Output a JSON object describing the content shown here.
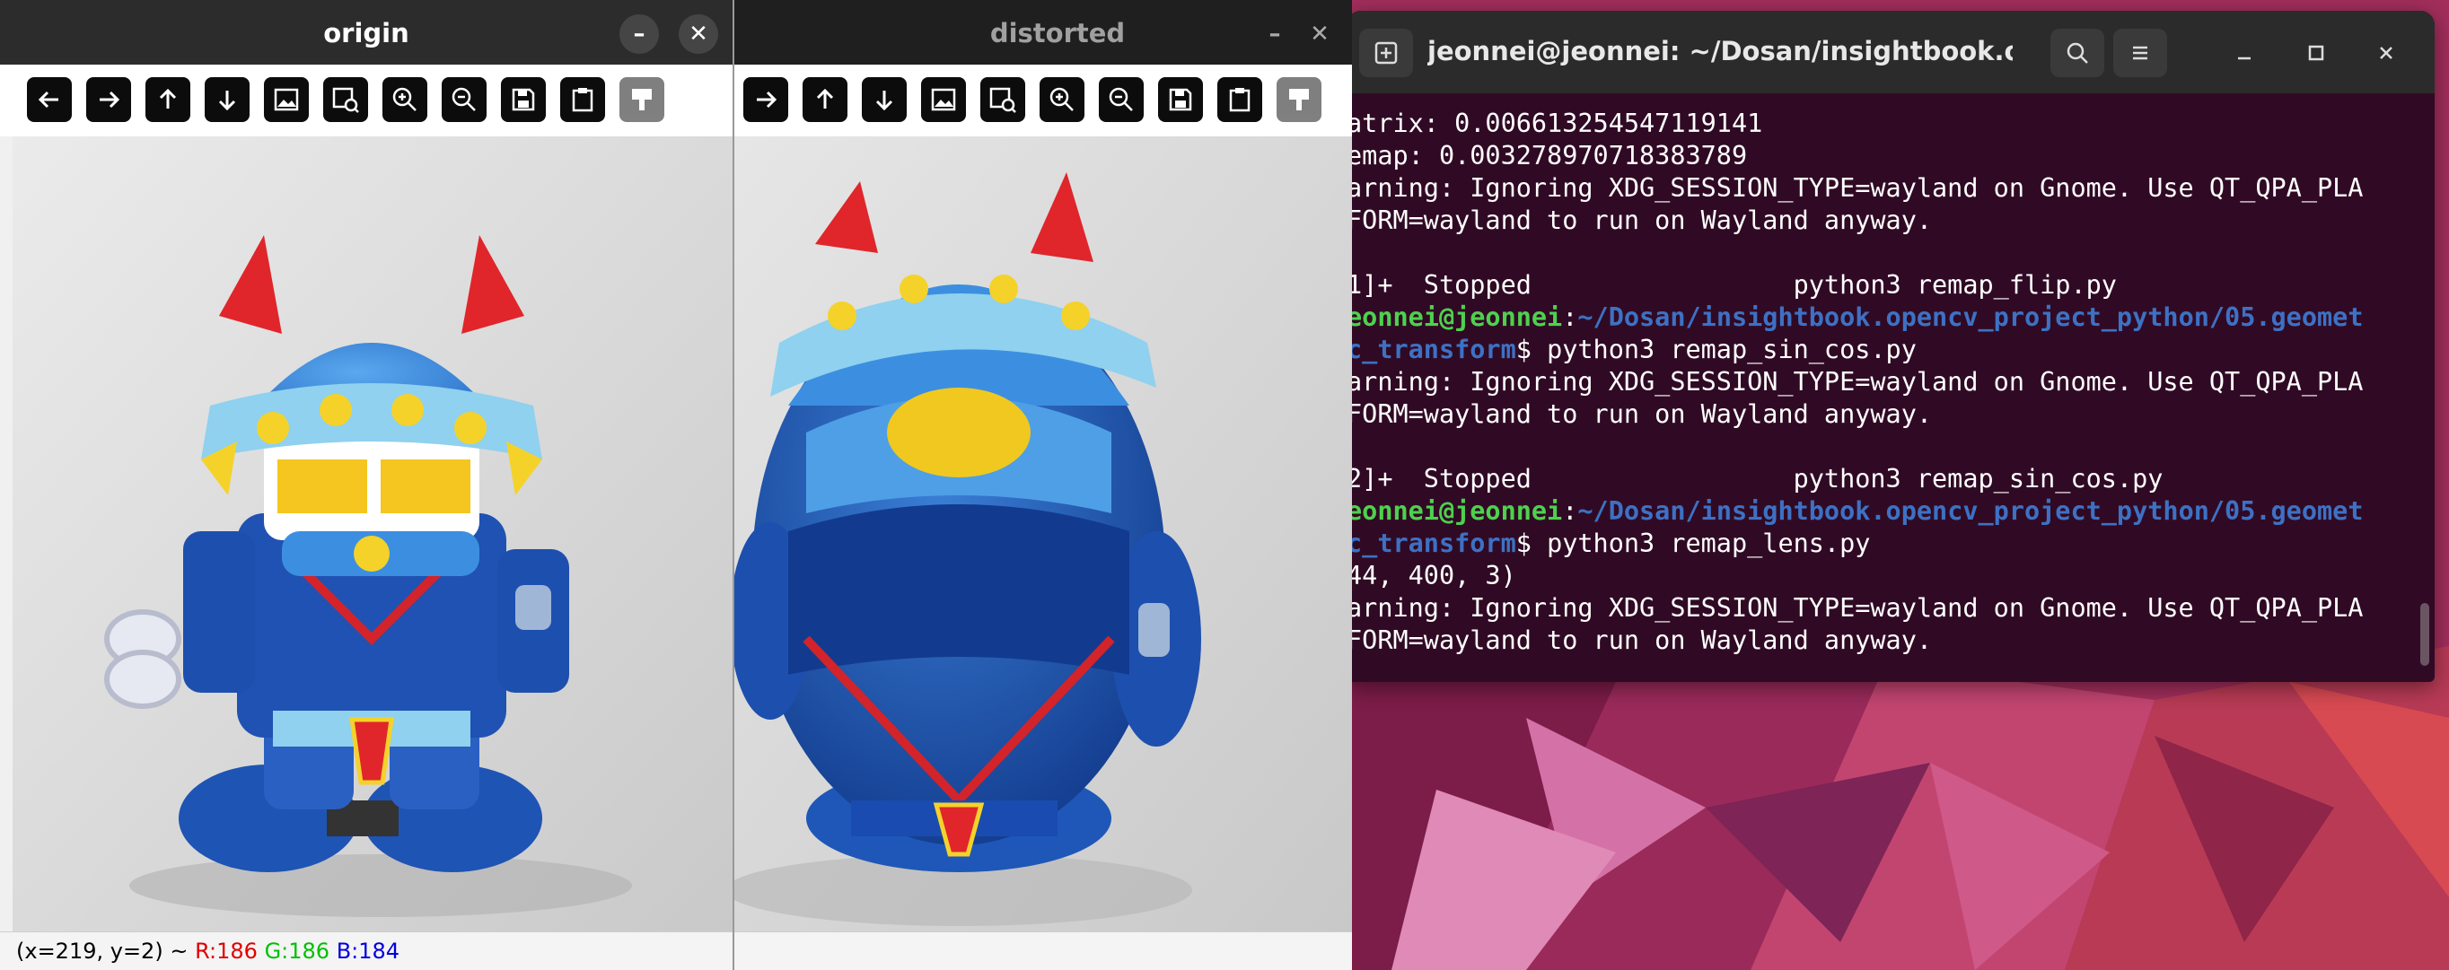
{
  "windows": {
    "origin": {
      "title": "origin"
    },
    "distorted": {
      "title": "distorted"
    }
  },
  "statusbar": {
    "coords": "(x=219, y=2) ~",
    "r": "R:186",
    "g": "G:186",
    "b": "B:184"
  },
  "toolbar_buttons": [
    "arrow-left-icon",
    "arrow-right-icon",
    "arrow-up-icon",
    "arrow-down-icon",
    "image-icon",
    "image-search-icon",
    "zoom-in-icon",
    "zoom-out-icon",
    "save-icon",
    "clipboard-icon",
    "properties-icon"
  ],
  "terminal": {
    "title": "jeonnei@jeonnei: ~/Dosan/insightbook.ope…",
    "lines": [
      {
        "text": "atrix: 0.006613254547119141"
      },
      {
        "text": "emap: 0.003278970718383789"
      },
      {
        "text": "arning: Ignoring XDG_SESSION_TYPE=wayland on Gnome. Use QT_QPA_PLA"
      },
      {
        "text": "FORM=wayland to run on Wayland anyway."
      },
      {
        "text": ""
      },
      {
        "text": "1]+  Stopped                 python3 remap_flip.py"
      },
      {
        "user": "eonnei@jeonnei",
        "sep": ":",
        "path": "~/Dosan/insightbook.opencv_project_python/05.geomet"
      },
      {
        "path": "c_transform",
        "cmd": "$ python3 remap_sin_cos.py"
      },
      {
        "text": "arning: Ignoring XDG_SESSION_TYPE=wayland on Gnome. Use QT_QPA_PLA"
      },
      {
        "text": "FORM=wayland to run on Wayland anyway."
      },
      {
        "text": ""
      },
      {
        "text": "2]+  Stopped                 python3 remap_sin_cos.py"
      },
      {
        "user": "eonnei@jeonnei",
        "sep": ":",
        "path": "~/Dosan/insightbook.opencv_project_python/05.geomet"
      },
      {
        "path": "c_transform",
        "cmd": "$ python3 remap_lens.py"
      },
      {
        "text": "44, 400, 3)"
      },
      {
        "text": "arning: Ignoring XDG_SESSION_TYPE=wayland on Gnome. Use QT_QPA_PLA"
      },
      {
        "text": "FORM=wayland to run on Wayland anyway."
      }
    ]
  },
  "colors": {
    "terminal_bg": "#300a24",
    "prompt_user": "#4ed14e",
    "prompt_path": "#3d71c4",
    "desktop": "#b8345f"
  }
}
